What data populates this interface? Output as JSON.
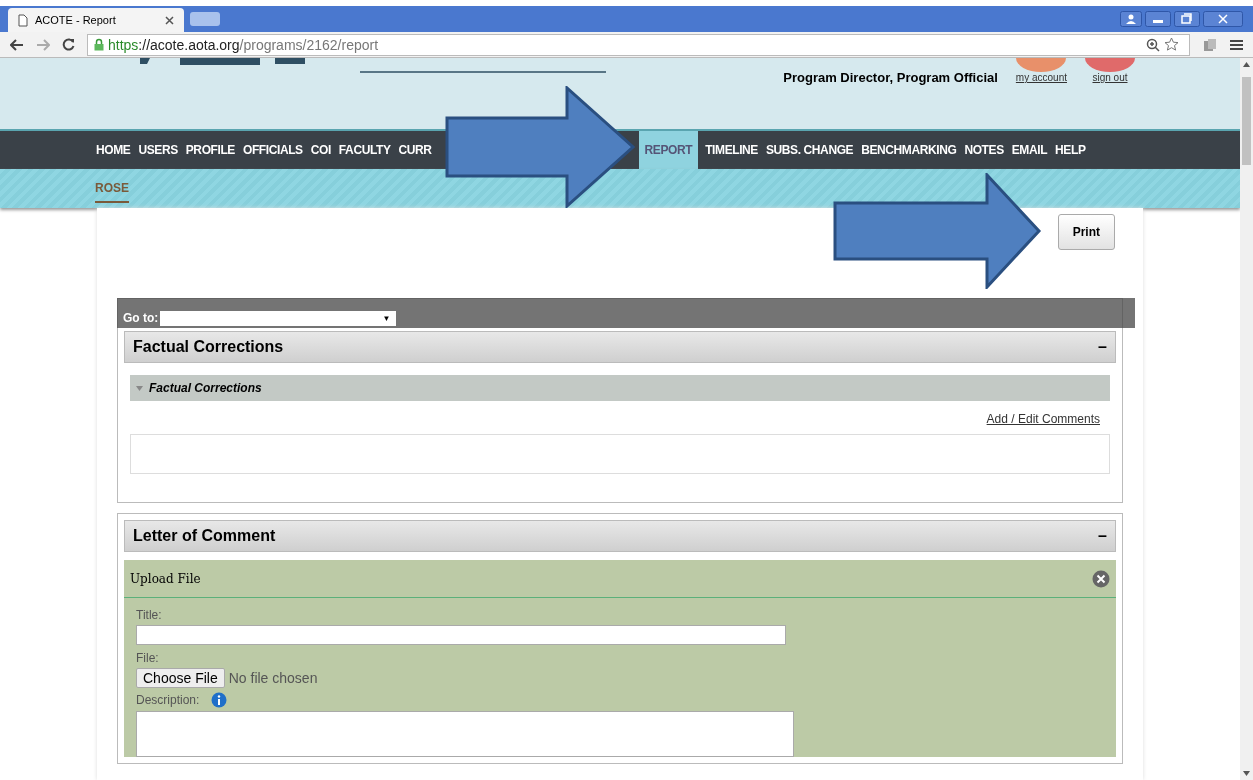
{
  "browser": {
    "tab_title": "ACOTE - Report",
    "url_scheme": "https",
    "url_host": "://acote.aota.org",
    "url_path": "/programs/2162/report"
  },
  "header": {
    "roles": "Program Director, Program Official",
    "links": [
      "my account",
      "sign out"
    ]
  },
  "nav": [
    {
      "label": "HOME",
      "selected": false
    },
    {
      "label": "USERS",
      "selected": false
    },
    {
      "label": "PROFILE",
      "selected": false
    },
    {
      "label": "OFFICIALS",
      "selected": false
    },
    {
      "label": "COI",
      "selected": false
    },
    {
      "label": "FACULTY",
      "selected": false
    },
    {
      "label": "CURR",
      "selected": false
    },
    {
      "label": "REPORT",
      "selected": true
    },
    {
      "label": "TIMELINE",
      "selected": false
    },
    {
      "label": "SUBS. CHANGE",
      "selected": false
    },
    {
      "label": "BENCHMARKING",
      "selected": false
    },
    {
      "label": "NOTES",
      "selected": false
    },
    {
      "label": "EMAIL",
      "selected": false
    },
    {
      "label": "HELP",
      "selected": false
    }
  ],
  "subnav": [
    {
      "label": "ROSE",
      "selected": true
    }
  ],
  "print_button": "Print",
  "goto": {
    "label": "Go to:",
    "arrow": "▼"
  },
  "sections": [
    {
      "kind": "comments",
      "title": "Factual Corrections",
      "collapse": "–",
      "subtitle": "Factual Corrections",
      "link": "Add / Edit Comments"
    },
    {
      "kind": "upload",
      "title": "Letter of Comment",
      "collapse": "–",
      "subtitle": "Upload File",
      "fields": [
        {
          "kind": "text",
          "label": "Title:"
        },
        {
          "kind": "file",
          "label": "File:",
          "button": "Choose File",
          "status": "No file chosen"
        },
        {
          "kind": "textarea",
          "label": "Description:",
          "info": true
        }
      ]
    }
  ]
}
